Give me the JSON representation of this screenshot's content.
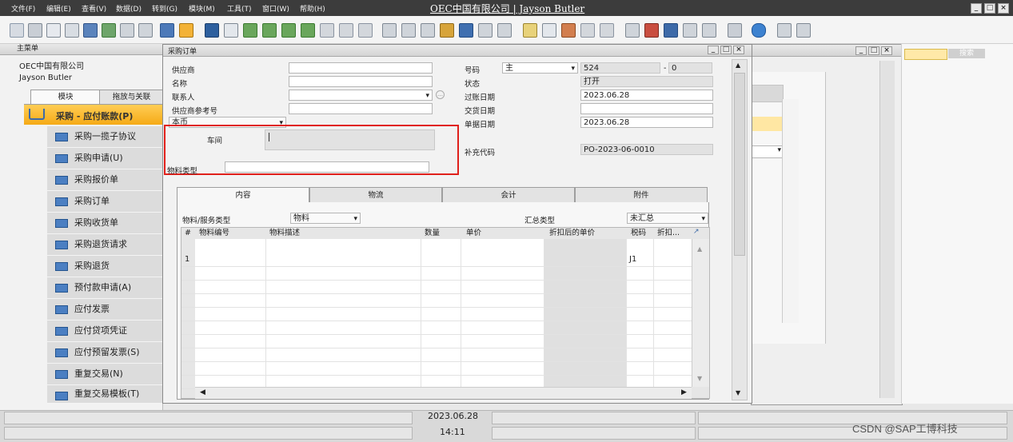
{
  "menubar": {
    "items": [
      "文件(F)",
      "编辑(E)",
      "查看(V)",
      "数据(D)",
      "转到(G)",
      "模块(M)",
      "工具(T)",
      "窗口(W)",
      "帮助(H)"
    ],
    "title": "OEC中国有限公司 | Jayson Butler"
  },
  "main_menu": {
    "header": "主菜单",
    "company": "OEC中国有限公司",
    "user": "Jayson Butler",
    "tabs": [
      "模块",
      "拖放与关联"
    ],
    "active_module": "采购 - 应付账款(P)",
    "items": [
      "采购一揽子协议",
      "采购申请(U)",
      "采购报价单",
      "采购订单",
      "采购收货单",
      "采购退货请求",
      "采购退货",
      "预付款申请(A)",
      "应付发票",
      "应付贷项凭证",
      "应付预留发票(S)",
      "重复交易(N)",
      "重复交易模板(T)"
    ]
  },
  "po": {
    "title": "采购订单",
    "vendor_label": "供应商",
    "name_label": "名称",
    "contact_label": "联系人",
    "vendor_ref_label": "供应商参考号",
    "currency": "本币",
    "workshop_label": "车间",
    "material_type_label": "物料类型",
    "number_label": "号码",
    "series": "主",
    "number": "524",
    "dash": "-",
    "number_sub": "0",
    "status_label": "状态",
    "status": "打开",
    "posting_date_label": "过账日期",
    "posting_date": "2023.06.28",
    "delivery_date_label": "交货日期",
    "doc_date_label": "单据日期",
    "doc_date": "2023.06.28",
    "supp_code_label": "补充代码",
    "supp_code": "PO-2023-06-0010",
    "tabs": [
      "内容",
      "物流",
      "会计",
      "附件"
    ],
    "item_type_label": "物料/服务类型",
    "item_type": "物料",
    "summary_type_label": "汇总类型",
    "summary_type": "未汇总",
    "columns": [
      "#",
      "物料编号",
      "物料描述",
      "数量",
      "单价",
      "折扣后的单价",
      "税码",
      "折扣..."
    ],
    "first_row": {
      "num": "1",
      "tax": "J1"
    },
    "highlight_color": "#e0201b"
  },
  "status": {
    "date": "2023.06.28",
    "time": "14:11"
  },
  "right": {
    "search_label": "搜索"
  },
  "watermark": "CSDN @SAP工博科技"
}
